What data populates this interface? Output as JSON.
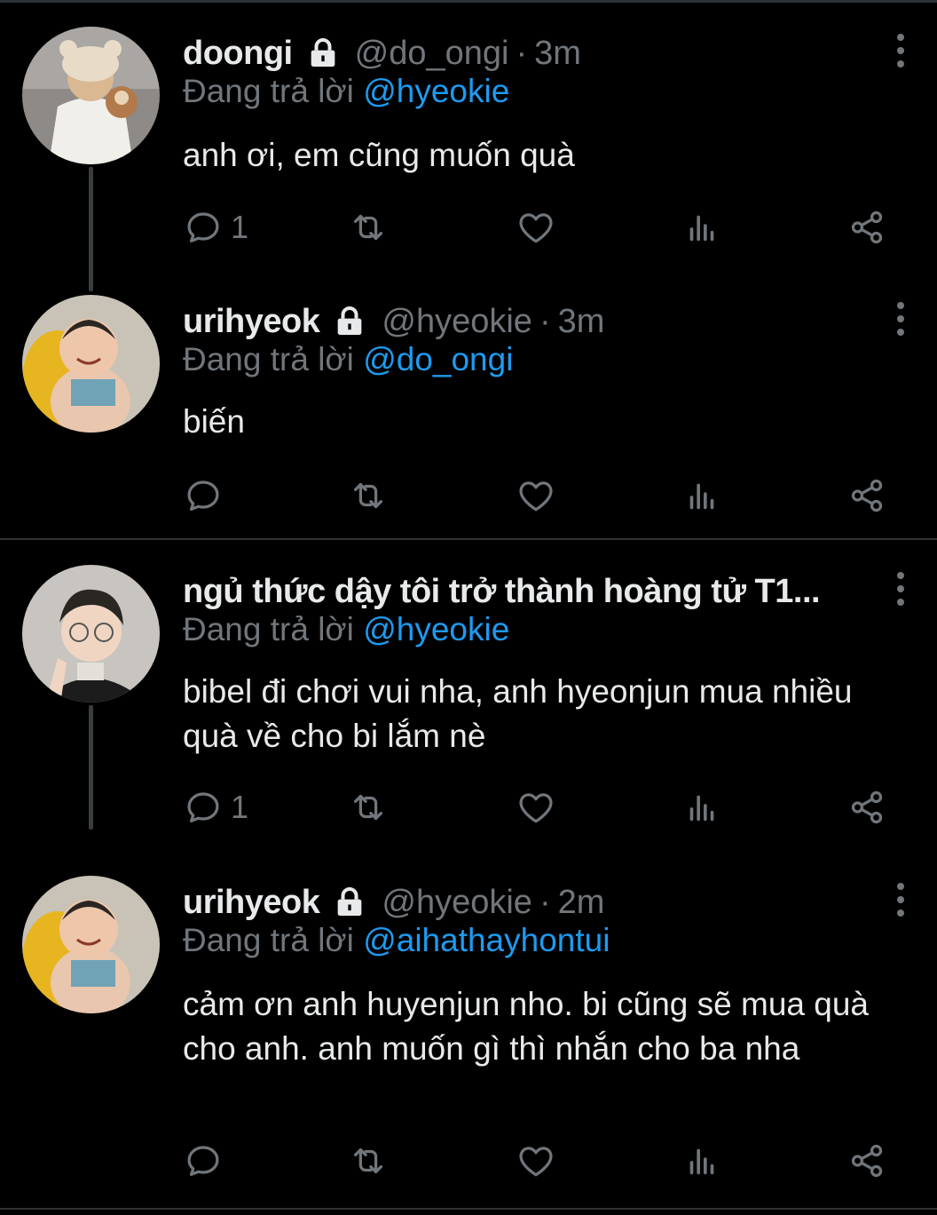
{
  "tweets": [
    {
      "name": "doongi",
      "handle": "@do_ongi",
      "dot": "·",
      "time": "3m",
      "reply_prefix": "Đang trả lời",
      "reply_to": "@hyeokie",
      "text": "anh ơi, em cũng muốn quà",
      "reply_count": "1",
      "protected": true
    },
    {
      "name": "urihyeok",
      "handle": "@hyeokie",
      "dot": "·",
      "time": "3m",
      "reply_prefix": "Đang trả lời",
      "reply_to": "@do_ongi",
      "text": "biến",
      "reply_count": "",
      "protected": true
    },
    {
      "name": "ngủ thức dậy tôi trở thành hoàng tử T1...",
      "handle": "",
      "dot": "",
      "time": "",
      "reply_prefix": "Đang trả lời",
      "reply_to": "@hyeokie",
      "text": "bibel đi chơi vui nha, anh hyeonjun mua nhiều quà về cho bi lắm nè",
      "reply_count": "1",
      "protected": false
    },
    {
      "name": "urihyeok",
      "handle": "@hyeokie",
      "dot": "·",
      "time": "2m",
      "reply_prefix": "Đang trả lời",
      "reply_to": "@aihathayhontui",
      "text": "cảm ơn anh huyenjun nho. bi cũng sẽ mua quà cho anh. anh muốn gì thì nhắn cho ba nha",
      "reply_count": "",
      "protected": true
    }
  ],
  "colors": {
    "background": "#000000",
    "text": "#e7e9ea",
    "muted": "#71767b",
    "link": "#1d9bf0",
    "divider": "#2f3336"
  },
  "icons": [
    "lock-icon",
    "more-icon",
    "reply-icon",
    "retweet-icon",
    "like-icon",
    "views-icon",
    "share-icon"
  ]
}
